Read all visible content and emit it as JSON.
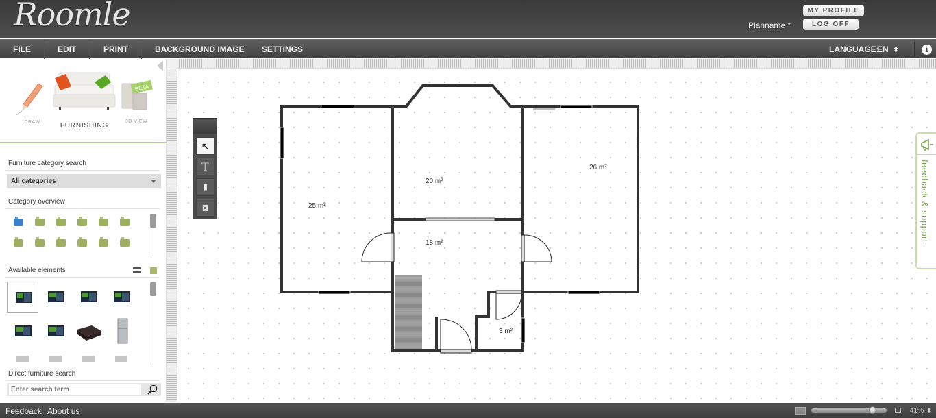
{
  "header": {
    "logo": "Roomle",
    "plan_name": "Planname *",
    "my_profile_label": "MY PROFILE",
    "log_off_label": "LOG OFF"
  },
  "menubar": {
    "items": [
      {
        "label": "FILE"
      },
      {
        "label": "EDIT"
      },
      {
        "label": "PRINT"
      },
      {
        "label": "BACKGROUND IMAGE"
      },
      {
        "label": "SETTINGS"
      }
    ],
    "language_label": "LANGUAGE:",
    "language_value": "EN",
    "language_spinner": "⬍",
    "info_icon": "i"
  },
  "sidebar": {
    "modes": [
      {
        "label": "DRAW",
        "icon": "pencil-icon"
      },
      {
        "label": "FURNISHING",
        "icon": "sofa-icon",
        "active": true
      },
      {
        "label": "3D VIEW",
        "icon": "3d-view-icon",
        "badge": "BETA"
      }
    ],
    "category_search_label": "Furniture category search",
    "category_select_value": "All categories",
    "category_overview_label": "Category overview",
    "categories": [
      {
        "icon": "bathtub-icon",
        "active": true
      },
      {
        "icon": "sink-icon"
      },
      {
        "icon": "toilet-icon"
      },
      {
        "icon": "corner-sofa-icon"
      },
      {
        "icon": "bed-icon"
      },
      {
        "icon": "chair-icon"
      },
      {
        "icon": "sofa-icon"
      },
      {
        "icon": "cabinet-icon"
      },
      {
        "icon": "plant-icon"
      },
      {
        "icon": "washing-machine-icon"
      },
      {
        "icon": "lamp-icon"
      },
      {
        "icon": "dresser-icon"
      }
    ],
    "available_elements_label": "Available elements",
    "view_toggle": {
      "list": "list-view-icon",
      "grid": "grid-view-icon",
      "active": "grid"
    },
    "elements": [
      {
        "icon": "tv-icon",
        "selected": true
      },
      {
        "icon": "tv-icon"
      },
      {
        "icon": "tv-icon"
      },
      {
        "icon": "tv-icon"
      },
      {
        "icon": "tv-icon"
      },
      {
        "icon": "tv-icon"
      },
      {
        "icon": "speaker-box-icon"
      },
      {
        "icon": "fridge-icon"
      },
      {
        "icon": "appliance-icon"
      },
      {
        "icon": "appliance-icon"
      },
      {
        "icon": "appliance-icon"
      },
      {
        "icon": "appliance-icon"
      }
    ],
    "direct_search_label": "Direct furniture search",
    "search_placeholder": "Enter search term"
  },
  "canvas": {
    "tools": [
      {
        "name": "select-move-tool",
        "glyph": "↖",
        "active": true
      },
      {
        "name": "text-tool",
        "glyph": "T"
      },
      {
        "name": "gradient-tool",
        "glyph": "▮"
      },
      {
        "name": "shape-tool",
        "glyph": "◘"
      }
    ],
    "rooms": [
      {
        "label": "25 m²"
      },
      {
        "label": "20 m²"
      },
      {
        "label": "26 m²"
      },
      {
        "label": "18 m²"
      },
      {
        "label": "3 m²"
      }
    ]
  },
  "feedback_tab": {
    "label": "feedback & support",
    "icon": "megaphone-icon"
  },
  "statusbar": {
    "links": [
      {
        "label": "Feedback"
      },
      {
        "label": "About us"
      }
    ],
    "zoom_percent": 41,
    "zoom_label": "41%",
    "zoom_spinner": "⬍",
    "zoom_slider_fraction": 0.82
  },
  "colors": {
    "accent_green": "#8bb04e",
    "header_bg": "#444444",
    "wall": "#333333"
  }
}
